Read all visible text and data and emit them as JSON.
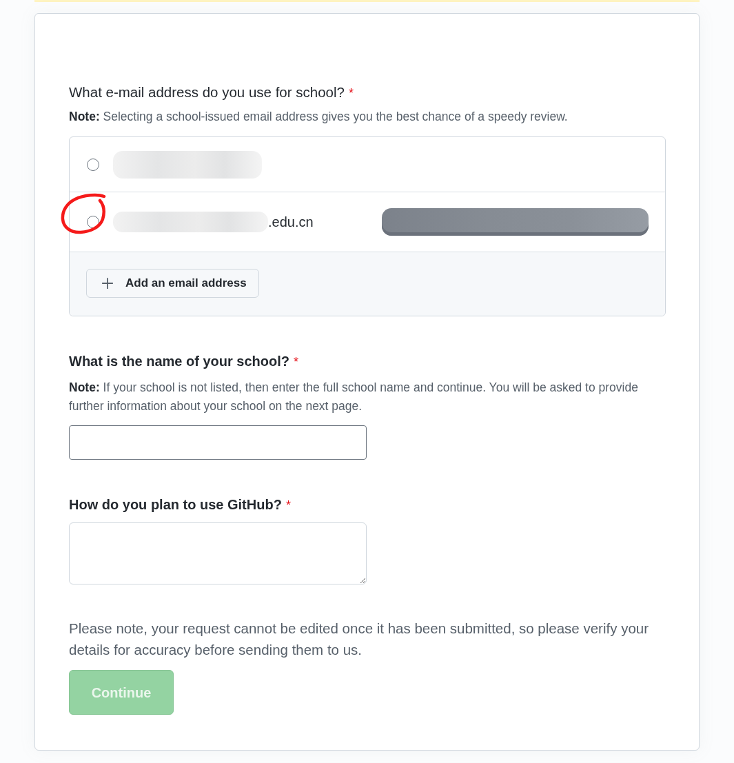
{
  "questions": [
    {
      "kind": "email_choice",
      "label": "What e-mail address do you use for school?",
      "label_bold": false,
      "required_mark": "*",
      "note": "**Note:** Selecting a school-issued email address gives you the best chance of a speedy review.",
      "options": [
        {
          "selected": false,
          "address_redacted": true,
          "annotated": false
        },
        {
          "selected": false,
          "address_redacted": true,
          "address_tail": ".edu.cn",
          "tag_redacted": true,
          "annotated": true
        }
      ],
      "add_button": "Add an email address"
    },
    {
      "kind": "text_input",
      "label": "What is the name of your school?",
      "label_bold": true,
      "required_mark": "*",
      "note": "**Note:** If your school is not listed, then enter the full school name and continue. You will be asked to provide further information about your school on the next page."
    },
    {
      "kind": "textarea",
      "label": "How do you plan to use GitHub?",
      "label_bold": true,
      "required_mark": "*"
    }
  ],
  "disclaimer": "Please note, your request cannot be edited once it has been submitted, so please verify your details for accuracy before sending them to us.",
  "continue_button": {
    "label": "Continue",
    "disabled": true
  }
}
